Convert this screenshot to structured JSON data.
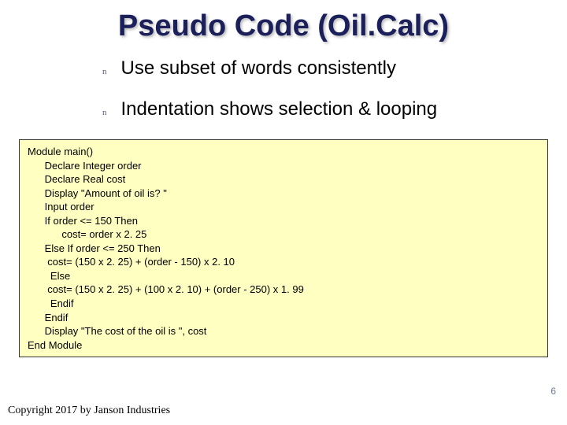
{
  "title": "Pseudo Code (Oil.Calc)",
  "bullets": [
    {
      "marker": "n",
      "text": "Use subset of words consistently"
    },
    {
      "marker": "n",
      "text": "Indentation shows selection & looping"
    }
  ],
  "code": "Module main()\n      Declare Integer order\n      Declare Real cost\n      Display \"Amount of oil is? \"\n      Input order\n      If order <= 150 Then\n            cost= order x 2. 25\n      Else If order <= 250 Then\n       cost= (150 x 2. 25) + (order - 150) x 2. 10\n        Else\n       cost= (150 x 2. 25) + (100 x 2. 10) + (order - 250) x 1. 99\n        Endif\n      Endif\n      Display \"The cost of the oil is \", cost\nEnd Module",
  "page_number": "6",
  "copyright": "Copyright 2017 by Janson Industries"
}
